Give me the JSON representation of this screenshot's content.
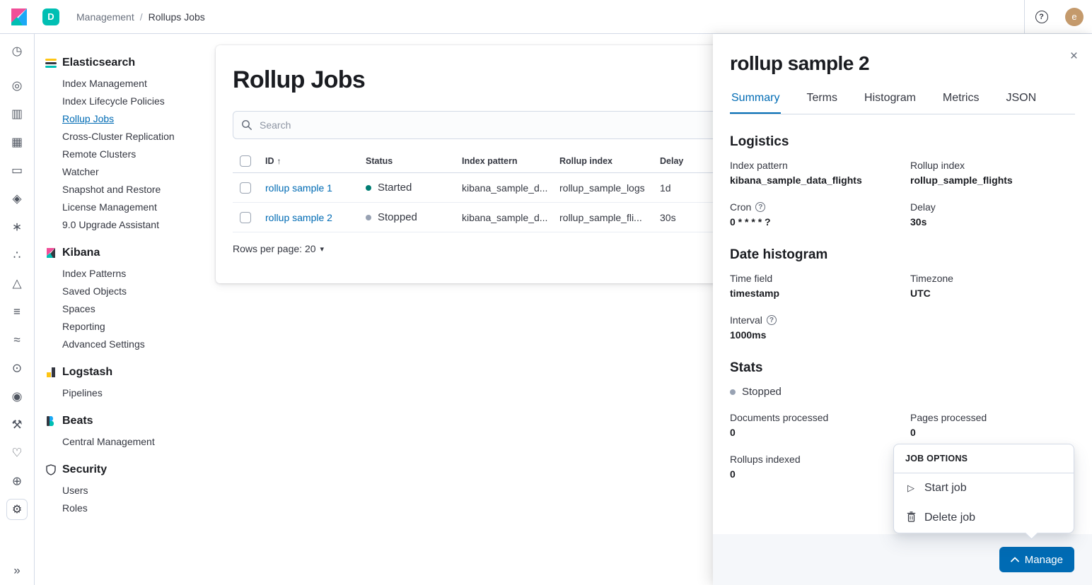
{
  "topbar": {
    "space_badge": "D",
    "breadcrumbs": {
      "parent": "Management",
      "separator": "/",
      "current": "Rollups Jobs"
    },
    "avatar_initial": "e"
  },
  "icon_rail": {
    "items": [
      {
        "name": "recently-viewed",
        "glyph": "◷"
      },
      {
        "name": "discover",
        "glyph": "◎"
      },
      {
        "name": "visualize",
        "glyph": "▥"
      },
      {
        "name": "dashboard",
        "glyph": "▦"
      },
      {
        "name": "canvas",
        "glyph": "▭"
      },
      {
        "name": "maps",
        "glyph": "◈"
      },
      {
        "name": "machine-learning",
        "glyph": "∗"
      },
      {
        "name": "graph",
        "glyph": "∴"
      },
      {
        "name": "apm",
        "glyph": "△"
      },
      {
        "name": "logs",
        "glyph": "≡"
      },
      {
        "name": "metrics",
        "glyph": "≈"
      },
      {
        "name": "uptime",
        "glyph": "⊙"
      },
      {
        "name": "siem",
        "glyph": "◉"
      },
      {
        "name": "dev-tools",
        "glyph": "⚒"
      },
      {
        "name": "stack-monitoring",
        "glyph": "♡"
      },
      {
        "name": "watcher",
        "glyph": "⊕"
      },
      {
        "name": "management",
        "glyph": "⚙"
      }
    ],
    "collapse_glyph": "»"
  },
  "sidebar": {
    "sections": [
      {
        "title": "Elasticsearch",
        "items": [
          "Index Management",
          "Index Lifecycle Policies",
          "Rollup Jobs",
          "Cross-Cluster Replication",
          "Remote Clusters",
          "Watcher",
          "Snapshot and Restore",
          "License Management",
          "9.0 Upgrade Assistant"
        ]
      },
      {
        "title": "Kibana",
        "items": [
          "Index Patterns",
          "Saved Objects",
          "Spaces",
          "Reporting",
          "Advanced Settings"
        ]
      },
      {
        "title": "Logstash",
        "items": [
          "Pipelines"
        ]
      },
      {
        "title": "Beats",
        "items": [
          "Central Management"
        ]
      },
      {
        "title": "Security",
        "items": [
          "Users",
          "Roles"
        ]
      }
    ],
    "selected_item": "Rollup Jobs"
  },
  "main": {
    "title": "Rollup Jobs",
    "search": {
      "placeholder": "Search"
    },
    "table": {
      "headers": [
        "ID",
        "Status",
        "Index pattern",
        "Rollup index",
        "Delay"
      ],
      "sort_icon": "↑",
      "rows": [
        {
          "id": "rollup sample 1",
          "status": "Started",
          "index_pattern": "kibana_sample_d...",
          "rollup_index": "rollup_sample_logs",
          "delay": "1d"
        },
        {
          "id": "rollup sample 2",
          "status": "Stopped",
          "index_pattern": "kibana_sample_d...",
          "rollup_index": "rollup_sample_fli...",
          "delay": "30s"
        }
      ]
    },
    "pagination": {
      "label": "Rows per page: 20",
      "chevron": "▾"
    }
  },
  "flyout": {
    "title": "rollup sample 2",
    "close_glyph": "×",
    "tabs": [
      {
        "label": "Summary"
      },
      {
        "label": "Terms"
      },
      {
        "label": "Histogram"
      },
      {
        "label": "Metrics"
      },
      {
        "label": "JSON"
      }
    ],
    "active_tab": "Summary",
    "help_glyph": "?",
    "logistics": {
      "heading": "Logistics",
      "index_pattern": {
        "label": "Index pattern",
        "value": "kibana_sample_data_flights"
      },
      "rollup_index": {
        "label": "Rollup index",
        "value": "rollup_sample_flights"
      },
      "cron": {
        "label": "Cron",
        "value": "0 * * * * ?"
      },
      "delay": {
        "label": "Delay",
        "value": "30s"
      }
    },
    "date_histogram": {
      "heading": "Date histogram",
      "time_field": {
        "label": "Time field",
        "value": "timestamp"
      },
      "timezone": {
        "label": "Timezone",
        "value": "UTC"
      },
      "interval": {
        "label": "Interval",
        "value": "1000ms"
      }
    },
    "stats": {
      "heading": "Stats",
      "status": "Stopped",
      "documents_processed": {
        "label": "Documents processed",
        "value": "0"
      },
      "pages_processed": {
        "label": "Pages processed",
        "value": "0"
      },
      "rollups_indexed": {
        "label": "Rollups indexed",
        "value": "0"
      }
    },
    "footer": {
      "manage_label": "Manage"
    }
  },
  "popover": {
    "title": "JOB OPTIONS",
    "items": [
      {
        "label": "Start job",
        "icon_glyph": "▷"
      },
      {
        "label": "Delete job"
      }
    ]
  },
  "colors": {
    "primary": "#006BB4",
    "started_dot": "#017D73",
    "stopped_dot": "#98A2B3",
    "border": "#D3DAE6",
    "text": "#343741",
    "subdued": "#69707D",
    "space_badge": "#00BFB3",
    "avatar": "#C49A6C",
    "kibana_pink": "#F04E98",
    "elastic_yellow": "#FEC514",
    "elastic_teal": "#00BFB3"
  }
}
